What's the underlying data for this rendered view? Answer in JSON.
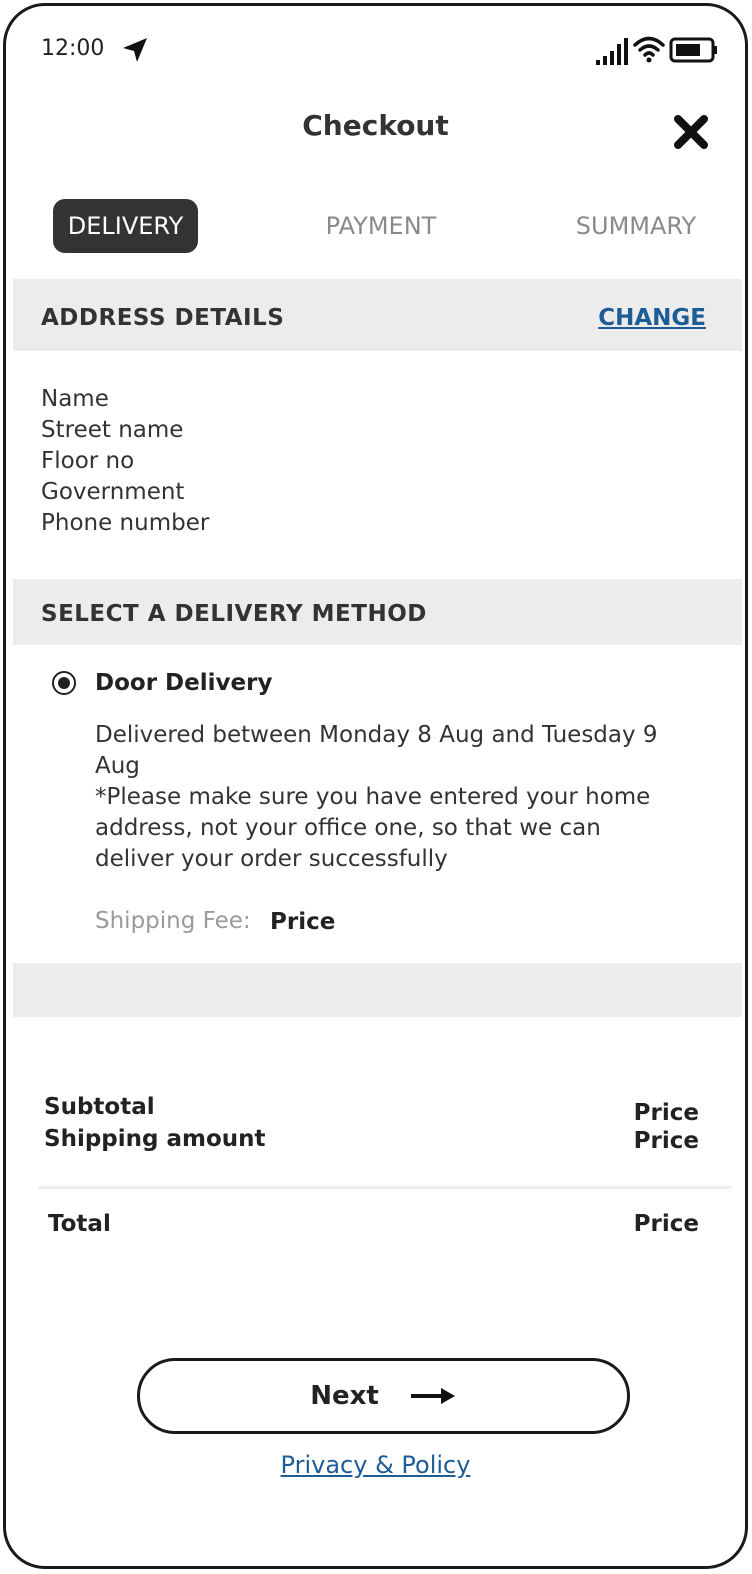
{
  "status_bar": {
    "time": "12:00",
    "icons": [
      "location-arrow-icon",
      "signal-icon",
      "wifi-icon",
      "battery-icon"
    ]
  },
  "header": {
    "title": "Checkout",
    "close_icon": "close-icon"
  },
  "tabs": [
    {
      "label": "DELIVERY",
      "active": true
    },
    {
      "label": "PAYMENT",
      "active": false
    },
    {
      "label": "SUMMARY",
      "active": false
    }
  ],
  "address_section": {
    "heading": "ADDRESS DETAILS",
    "change_label": "CHANGE",
    "lines": [
      "Name",
      "Street name",
      "Floor no",
      "Government",
      "Phone number"
    ]
  },
  "delivery_section": {
    "heading": "SELECT A DELIVERY METHOD",
    "option": {
      "label": "Door Delivery",
      "selected": true,
      "description_line1": "Delivered between Monday 8 Aug and Tuesday 9 Aug",
      "description_line2": "*Please make sure you have entered your home address, not your office one, so that we can deliver your order successfully",
      "fee_label": "Shipping Fee:",
      "fee_value": "Price"
    }
  },
  "summary": {
    "subtotal_label": "Subtotal",
    "subtotal_value": "Price",
    "shipping_label": "Shipping amount",
    "shipping_value": "Price",
    "total_label": "Total",
    "total_value": "Price"
  },
  "footer": {
    "next_label": "Next",
    "privacy_label": "Privacy & Policy"
  },
  "colors": {
    "active_tab_bg": "#333333",
    "inactive_tab_text": "#8a8a8a",
    "section_bg": "#ececec",
    "link": "#1e5c96"
  }
}
